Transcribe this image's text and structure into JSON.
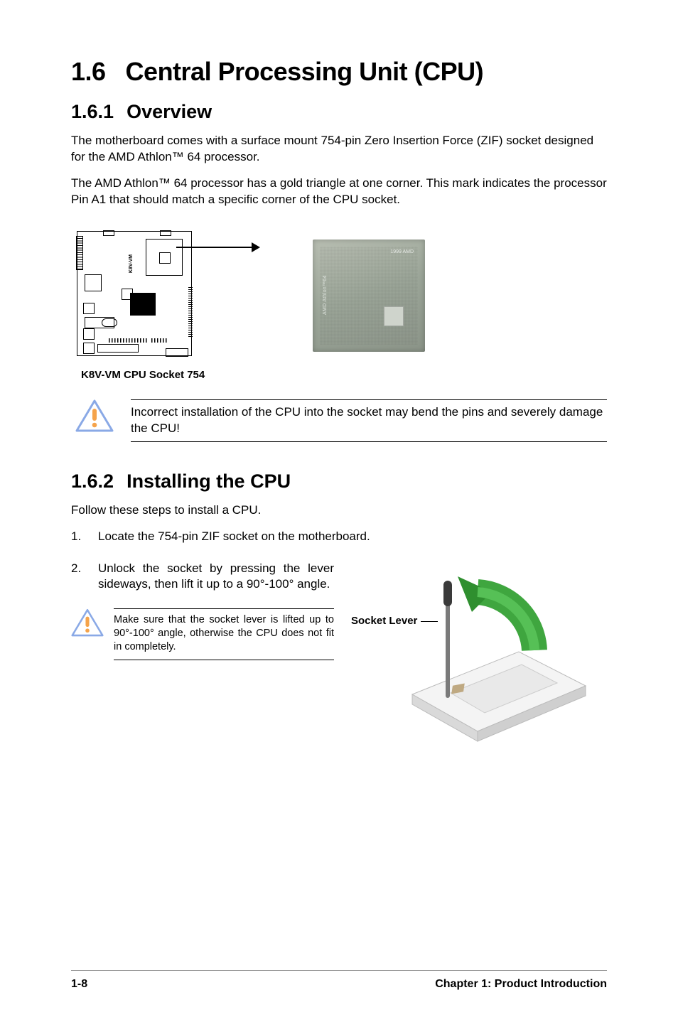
{
  "heading": {
    "number": "1.6",
    "title": "Central Processing Unit (CPU)"
  },
  "section1": {
    "number": "1.6.1",
    "title": "Overview",
    "p1": "The motherboard comes with a surface mount 754-pin Zero Insertion Force (ZIF) socket designed for the AMD Athlon™ 64 processor.",
    "p2": "The AMD Athlon™ 64 processor has a gold triangle at one corner. This mark indicates the processor Pin A1 that should match a specific corner of the CPU socket."
  },
  "figure1": {
    "board_label": "K8V-VM",
    "caption": "K8V-VM CPU Socket 754",
    "cpu_side_text": "AMD Athlon™64",
    "cpu_top_text": "1999 AMD"
  },
  "warning1": "Incorrect installation of the CPU into the socket may bend the pins and severely damage the CPU!",
  "section2": {
    "number": "1.6.2",
    "title": "Installing the CPU",
    "intro": "Follow these steps to install a CPU.",
    "step1_num": "1.",
    "step1": "Locate the 754-pin ZIF socket on the motherboard.",
    "step2_num": "2.",
    "step2": "Unlock the socket by pressing the lever sideways, then lift it up to a 90°-100° angle.",
    "socket_label": "Socket Lever",
    "mini_warning": "Make sure that the socket lever is lifted up to 90°-100° angle, otherwise the CPU does not fit in completely."
  },
  "footer": {
    "page": "1-8",
    "chapter": "Chapter 1: Product Introduction"
  }
}
